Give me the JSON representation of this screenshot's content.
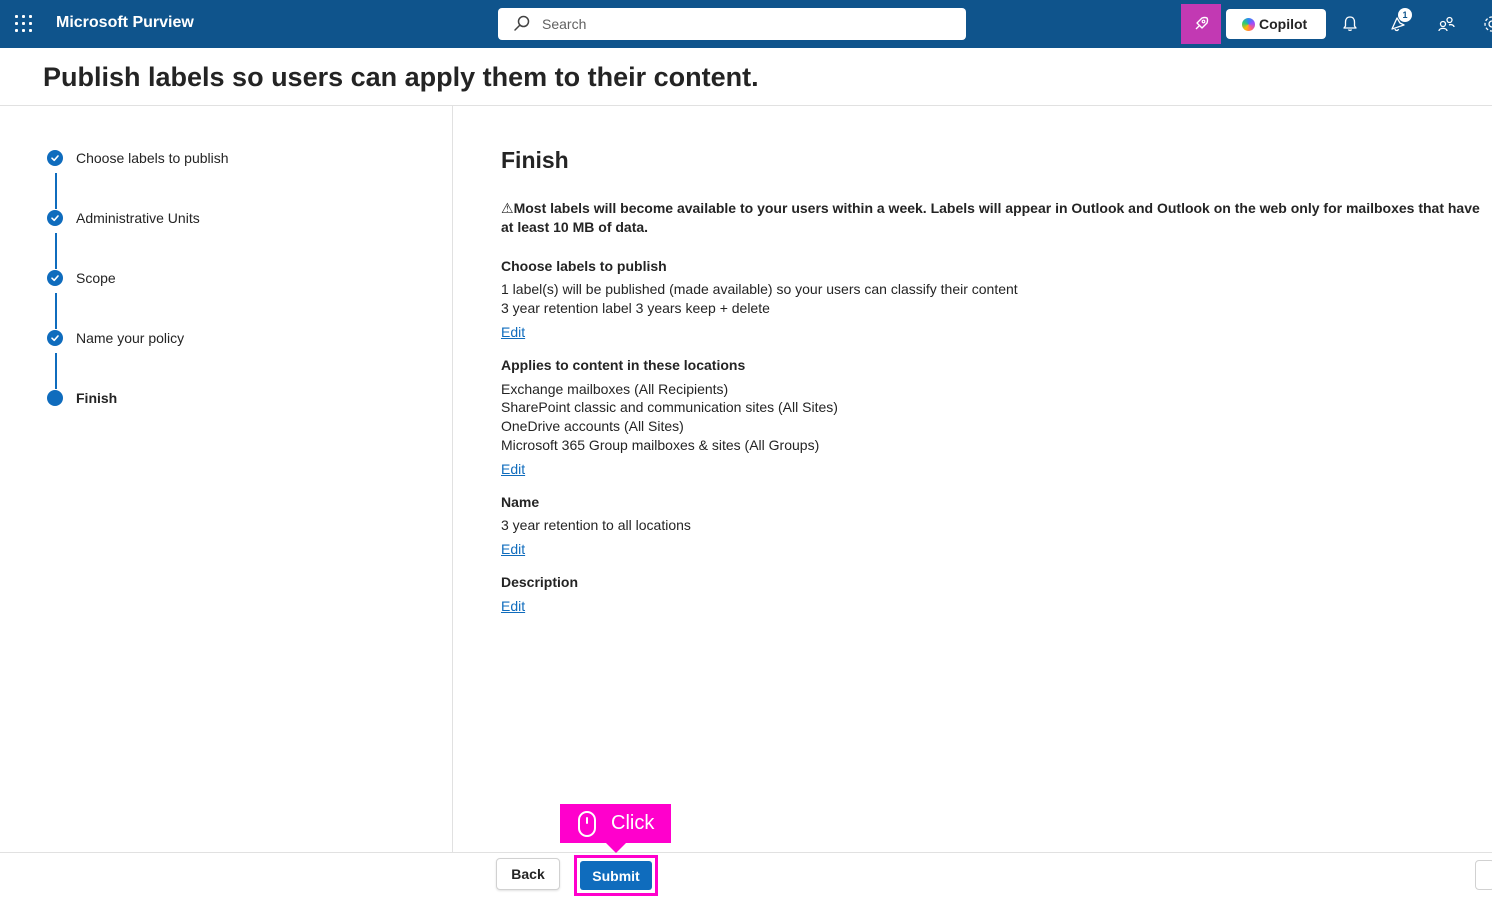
{
  "topbar": {
    "app_title": "Microsoft Purview",
    "search_placeholder": "Search",
    "copilot_label": "Copilot",
    "notification_badge": "1",
    "icons": [
      "waffle-icon",
      "search-icon",
      "rocket-icon",
      "bell-icon",
      "notification-icon",
      "people-icon",
      "settings-icon"
    ]
  },
  "page": {
    "heading": "Publish labels so users can apply them to their content."
  },
  "steps": [
    {
      "label": "Choose labels to publish",
      "state": "complete"
    },
    {
      "label": "Administrative Units",
      "state": "complete"
    },
    {
      "label": "Scope",
      "state": "complete"
    },
    {
      "label": "Name your policy",
      "state": "complete"
    },
    {
      "label": "Finish",
      "state": "current"
    }
  ],
  "finish": {
    "title": "Finish",
    "warning_icon": "⚠",
    "warning": "Most labels will become available to your users within a week. Labels will appear in Outlook and Outlook on the web only for mailboxes that have at least 10 MB of data.",
    "sections": [
      {
        "heading": "Choose labels to publish",
        "lines": [
          "1 label(s) will be published (made available) so your users can classify their content",
          "3 year retention label 3 years keep + delete"
        ],
        "edit": "Edit"
      },
      {
        "heading": "Applies to content in these locations",
        "lines": [
          "Exchange mailboxes (All Recipients)",
          "SharePoint classic and communication sites (All Sites)",
          "OneDrive accounts (All Sites)",
          "Microsoft 365 Group mailboxes & sites (All Groups)"
        ],
        "edit": "Edit"
      },
      {
        "heading": "Name",
        "lines": [
          "3 year retention to all locations"
        ],
        "edit": "Edit"
      },
      {
        "heading": "Description",
        "lines": [],
        "edit": "Edit"
      }
    ]
  },
  "footer": {
    "back_label": "Back",
    "submit_label": "Submit"
  },
  "overlay": {
    "click_label": "Click"
  },
  "colors": {
    "topbar": "#0f548c",
    "accent": "#0f6cbd",
    "highlight": "#ff00cc",
    "rocket_button": "#c239b3"
  }
}
